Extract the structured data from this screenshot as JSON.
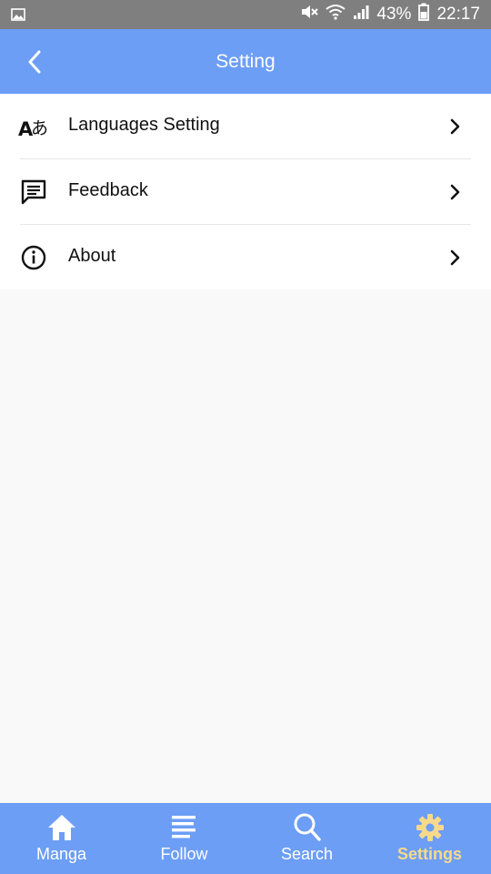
{
  "status_bar": {
    "battery": "43%",
    "time": "22:17"
  },
  "header": {
    "title": "Setting"
  },
  "menu": {
    "items": [
      {
        "label": "Languages Setting",
        "icon": "translate-icon"
      },
      {
        "label": "Feedback",
        "icon": "feedback-icon"
      },
      {
        "label": "About",
        "icon": "info-icon"
      }
    ]
  },
  "bottom_nav": {
    "items": [
      {
        "label": "Manga",
        "icon": "home-icon"
      },
      {
        "label": "Follow",
        "icon": "list-icon"
      },
      {
        "label": "Search",
        "icon": "search-icon"
      },
      {
        "label": "Settings",
        "icon": "gear-icon",
        "active": true
      }
    ]
  },
  "colors": {
    "primary": "#6c9ef6",
    "status_bar": "#7f7f7f",
    "active_tab": "#f7d98b",
    "background": "#f9f9f9"
  }
}
